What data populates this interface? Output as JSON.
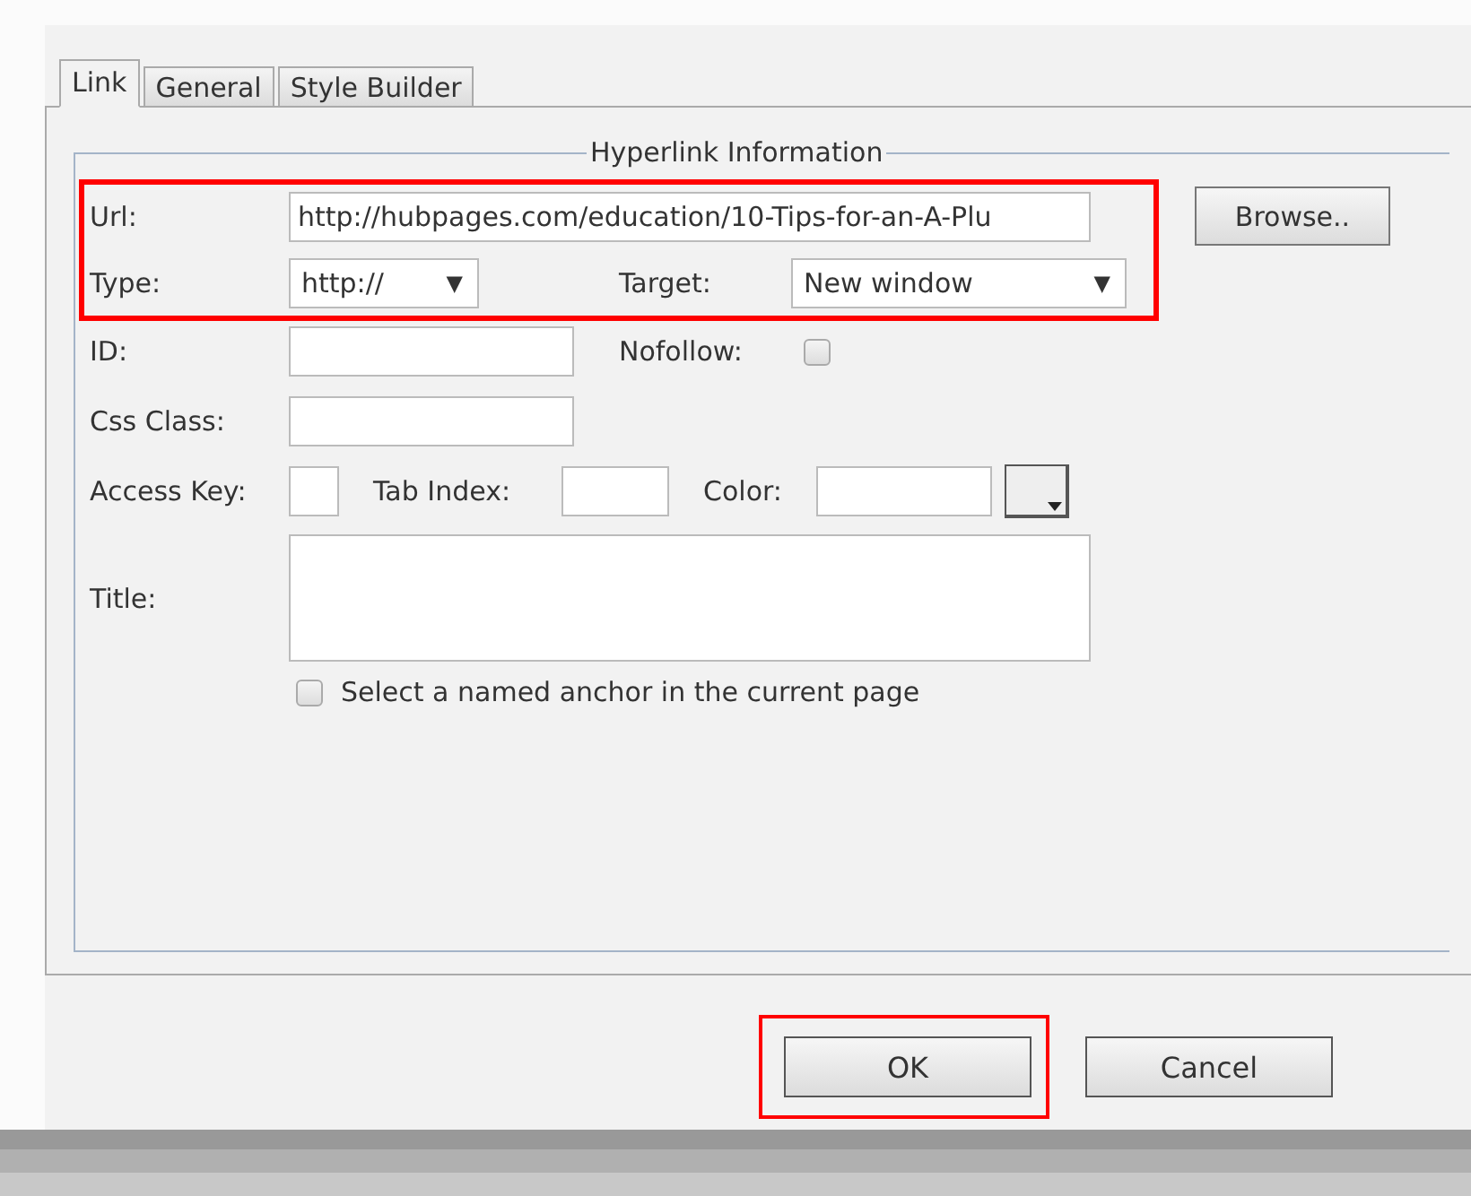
{
  "tabs": [
    {
      "label": "Link",
      "selected": true
    },
    {
      "label": "General",
      "selected": false
    },
    {
      "label": "Style Builder",
      "selected": false
    }
  ],
  "fieldset": {
    "legend": "Hyperlink Information"
  },
  "highlighted_group": {
    "highlighted": true,
    "url": {
      "label": "Url:",
      "value": "http://hubpages.com/education/10-Tips-for-an-A-Plu"
    },
    "type": {
      "label": "Type:",
      "value": "http://",
      "arrow": "▼"
    },
    "target": {
      "label": "Target:",
      "value": "New window",
      "arrow": "▼"
    }
  },
  "browse_button": "Browse..",
  "id": {
    "label": "ID:"
  },
  "nofollow": {
    "label": "Nofollow:",
    "checked": false
  },
  "css_class": {
    "label": "Css Class:"
  },
  "access_key": {
    "label": "Access Key:"
  },
  "tab_index": {
    "label": "Tab Index:"
  },
  "color": {
    "label": "Color:"
  },
  "title": {
    "label": "Title:"
  },
  "anchor_checkbox": {
    "label": "Select a named anchor in the current page",
    "checked": false
  },
  "buttons": [
    {
      "label": "OK",
      "highlighted": true
    },
    {
      "label": "Cancel",
      "highlighted": false
    }
  ]
}
